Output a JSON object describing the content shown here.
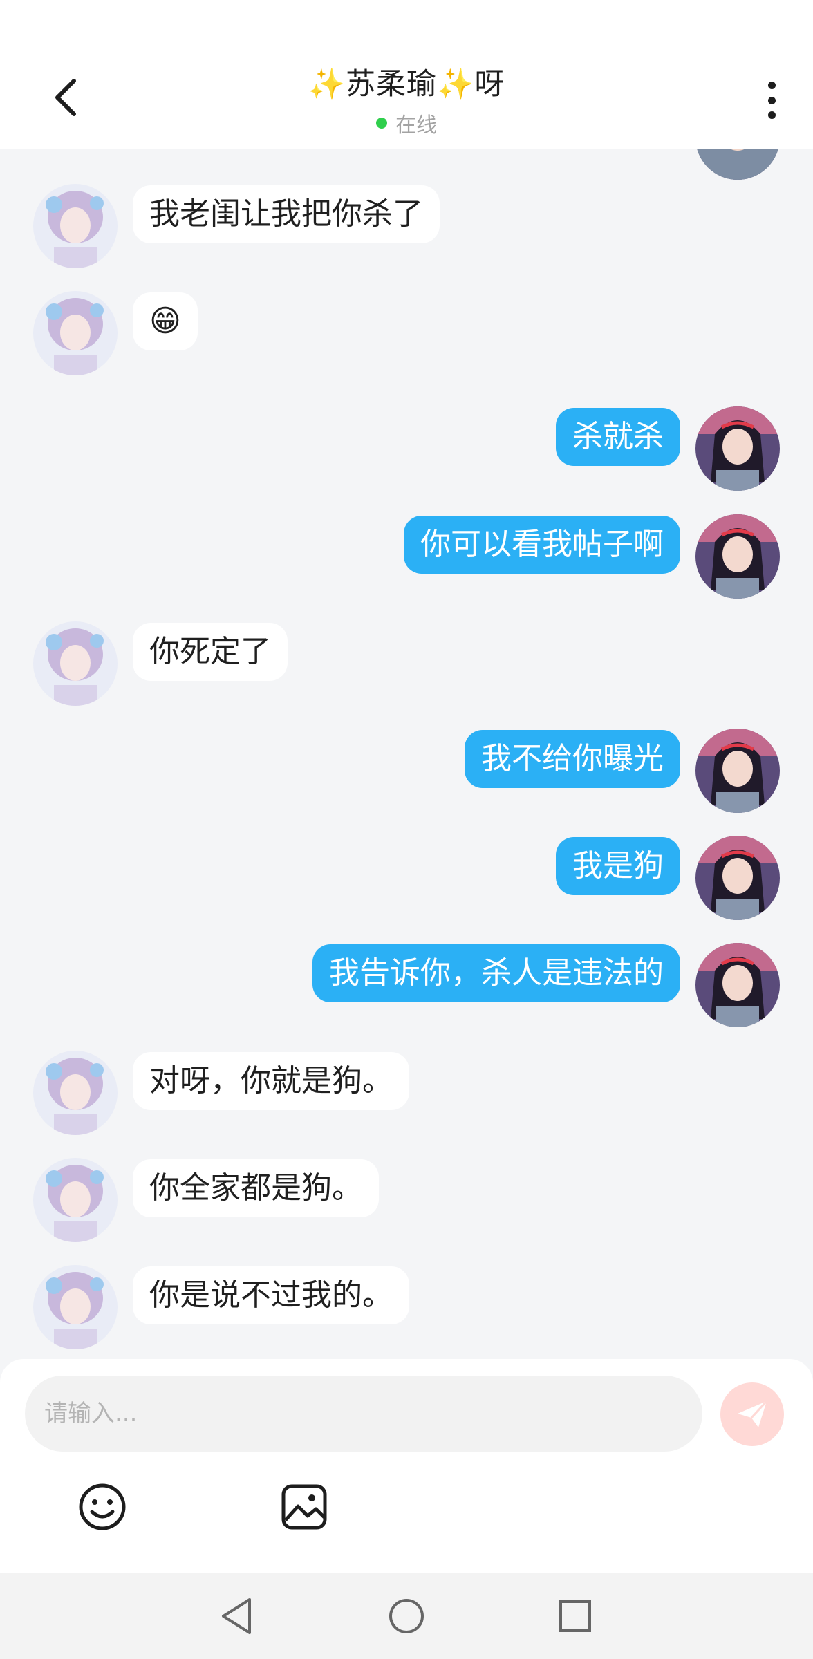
{
  "header": {
    "title": "✨苏柔瑜✨呀",
    "status": "在线",
    "status_color": "#2fcf4c"
  },
  "messages": [
    {
      "side": "left",
      "text": "我老闺让我把你杀了"
    },
    {
      "side": "left",
      "text": "😁"
    },
    {
      "side": "right",
      "text": "杀就杀"
    },
    {
      "side": "right",
      "text": "你可以看我帖子啊"
    },
    {
      "side": "left",
      "text": "你死定了"
    },
    {
      "side": "right",
      "text": "我不给你曝光"
    },
    {
      "side": "right",
      "text": "我是狗"
    },
    {
      "side": "right",
      "text": "我告诉你，杀人是违法的"
    },
    {
      "side": "left",
      "text": "对呀，你就是狗。"
    },
    {
      "side": "left",
      "text": "你全家都是狗。"
    },
    {
      "side": "left",
      "text": "你是说不过我的。"
    }
  ],
  "input": {
    "placeholder": "请输入..."
  },
  "colors": {
    "sent_bubble": "#2bb0f5",
    "received_bubble": "#ffffff",
    "send_button": "#ffd9d6",
    "background": "#f4f5f7"
  },
  "icons": {
    "back": "chevron-left-icon",
    "more": "more-vertical-icon",
    "send": "paper-plane-icon",
    "emoji": "smiley-icon",
    "image": "image-icon",
    "nav_back": "triangle-back-icon",
    "nav_home": "circle-home-icon",
    "nav_recent": "square-recent-icon"
  }
}
